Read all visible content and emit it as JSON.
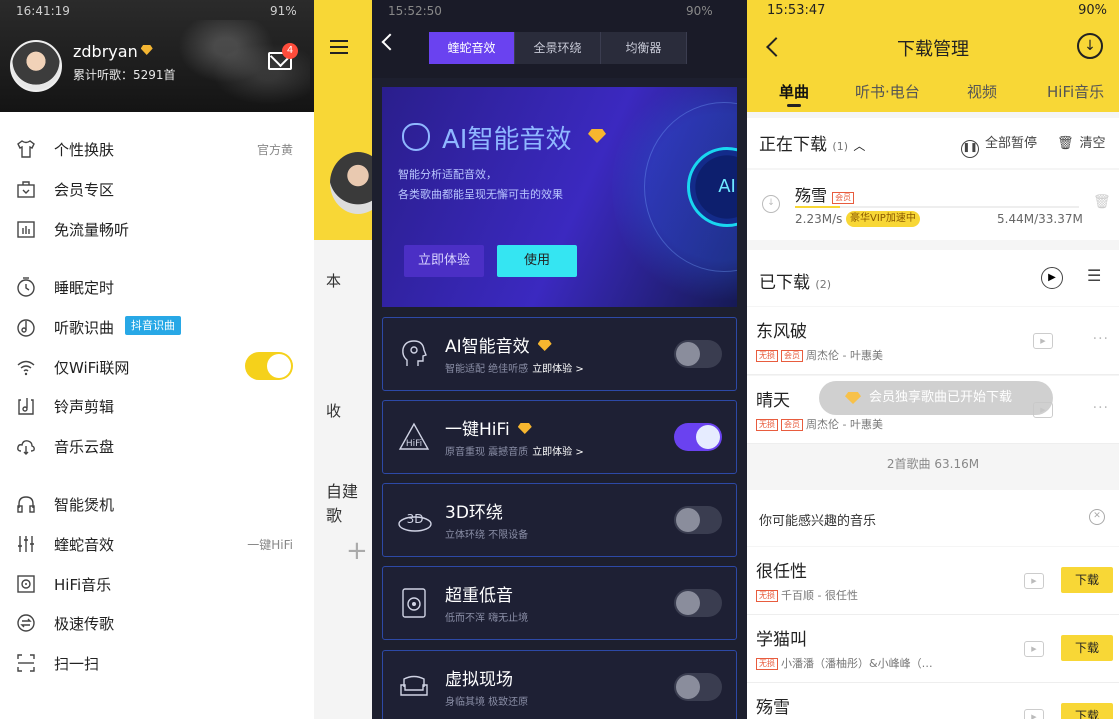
{
  "panel1": {
    "status_time": "16:41:19",
    "status_battery": "91%",
    "user": {
      "name": "zdbryan",
      "stats": "累计听歌：5291首",
      "mail_badge": "4"
    },
    "menu": [
      {
        "label": "个性换肤",
        "icon": "shirt-icon",
        "right": "官方黄"
      },
      {
        "label": "会员专区",
        "icon": "vip-bag-icon"
      },
      {
        "label": "免流量畅听",
        "icon": "sim-card-icon"
      },
      {
        "label": "睡眠定时",
        "icon": "timer-icon"
      },
      {
        "label": "听歌识曲",
        "icon": "music-recognize-icon",
        "tag": "抖音识曲"
      },
      {
        "label": "仅WiFi联网",
        "icon": "wifi-icon",
        "toggle": true
      },
      {
        "label": "铃声剪辑",
        "icon": "ringtone-icon"
      },
      {
        "label": "音乐云盘",
        "icon": "cloud-icon"
      },
      {
        "label": "智能煲机",
        "icon": "headphone-icon"
      },
      {
        "label": "蝰蛇音效",
        "icon": "equalizer-icon",
        "right": "一键HiFi"
      },
      {
        "label": "HiFi音乐",
        "icon": "hifi-icon"
      },
      {
        "label": "极速传歌",
        "icon": "transfer-icon"
      },
      {
        "label": "扫一扫",
        "icon": "scan-icon"
      }
    ],
    "background_fragments": {
      "section": "自建歌",
      "col1": "本",
      "col2": "收"
    }
  },
  "panel2": {
    "status_time": "15:52:50",
    "status_battery": "90%",
    "tabs": [
      "蝰蛇音效",
      "全景环绕",
      "均衡器"
    ],
    "banner": {
      "title": "AI智能音效",
      "sub1": "智能分析适配音效，",
      "sub2": "各类歌曲都能呈现无懈可击的效果",
      "try_label": "立即体验",
      "use_label": "使用",
      "orb": "AI"
    },
    "cards": [
      {
        "title": "AI智能音效",
        "sub": "智能适配 绝佳听感",
        "link": "立即体验 >",
        "gem": true,
        "on": false,
        "icon": "ai-head-icon"
      },
      {
        "title": "一键HiFi",
        "sub": "原音重现 震撼音质",
        "link": "立即体验 >",
        "gem": true,
        "on": true,
        "icon": "hifi-icon"
      },
      {
        "title": "3D环绕",
        "sub": "立体环绕 不限设备",
        "link": "",
        "gem": false,
        "on": false,
        "icon": "3d-icon"
      },
      {
        "title": "超重低音",
        "sub": "低而不浑 嗨无止境",
        "link": "",
        "gem": false,
        "on": false,
        "icon": "speaker-icon"
      },
      {
        "title": "虚拟现场",
        "sub": "身临其境 极致还原",
        "link": "",
        "gem": false,
        "on": false,
        "icon": "sofa-icon"
      }
    ]
  },
  "panel3": {
    "status_time": "15:53:47",
    "status_battery": "90%",
    "title": "下载管理",
    "tabs": [
      "单曲",
      "听书·电台",
      "视频",
      "HiFi音乐"
    ],
    "downloading": {
      "title": "正在下载",
      "count": "(1)",
      "pause_all": "全部暂停",
      "clear": "清空",
      "song": "殇雪",
      "speed": "2.23M/s",
      "vip_tag": "豪华VIP加速中",
      "size": "5.44M/33.37M",
      "progress": 0.16
    },
    "downloaded": {
      "title": "已下载",
      "count": "(2)",
      "songs": [
        {
          "name": "东风破",
          "artist": "周杰伦 - 叶惠美"
        },
        {
          "name": "晴天",
          "artist": "周杰伦 - 叶惠美"
        }
      ],
      "summary": "2首歌曲 63.16M"
    },
    "toast": "会员独享歌曲已开始下载",
    "recommend": {
      "title": "你可能感兴趣的音乐",
      "download_label": "下载",
      "songs": [
        {
          "name": "很任性",
          "artist": "千百顺 - 很任性"
        },
        {
          "name": "学猫叫",
          "artist": "小潘潘（潘柚彤）&小峰峰（…"
        },
        {
          "name": "殇雪",
          "artist": ""
        }
      ]
    }
  }
}
